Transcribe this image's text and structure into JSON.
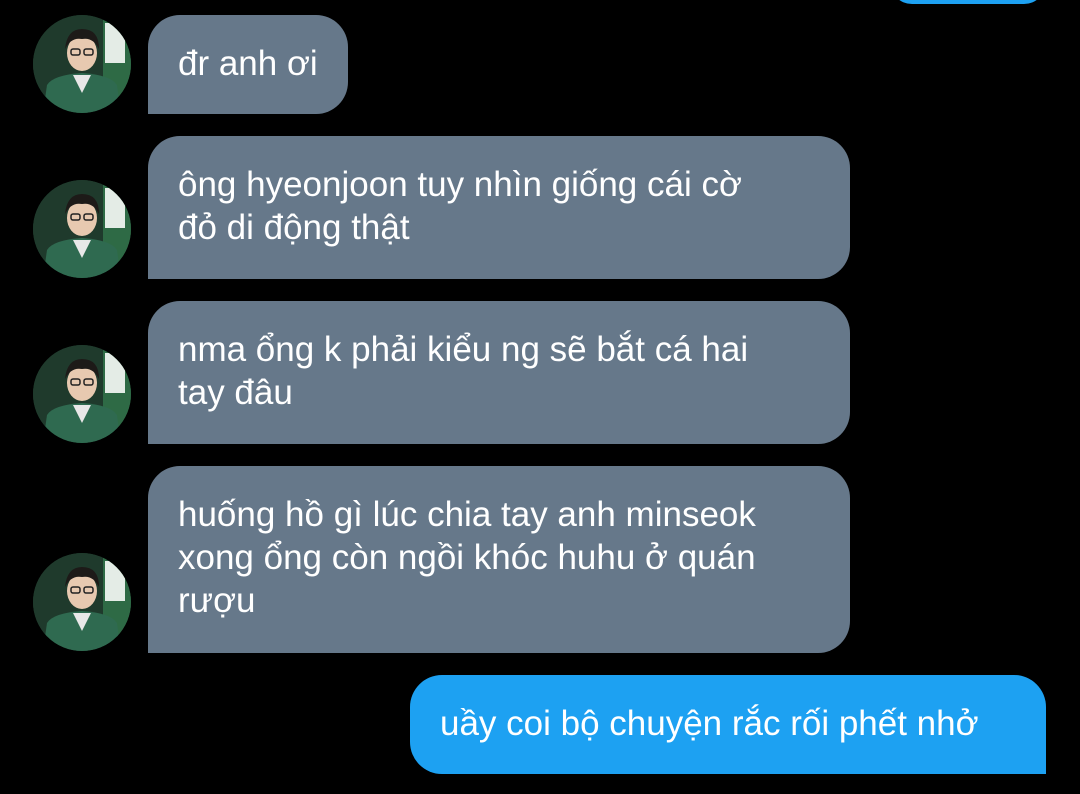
{
  "conversation": {
    "messages": [
      {
        "direction": "received",
        "text": "đr anh ơi"
      },
      {
        "direction": "received",
        "text": "ông hyeonjoon tuy nhìn giống cái cờ\nđỏ di động thật"
      },
      {
        "direction": "received",
        "text": "nma ổng k phải kiểu ng sẽ bắt cá hai\ntay đâu"
      },
      {
        "direction": "received",
        "text": "huống hồ gì lúc chia tay anh minseok\nxong ổng còn ngồi khóc huhu ở quán\nrượu"
      },
      {
        "direction": "sent",
        "text": "uầy coi bộ chuyện rắc rối phết nhở"
      }
    ]
  },
  "colors": {
    "background": "#000000",
    "received_bubble": "#66788a",
    "sent_bubble": "#1da1f2",
    "text": "#ffffff"
  },
  "icons": {
    "avatar": "profile-photo-avatar"
  }
}
